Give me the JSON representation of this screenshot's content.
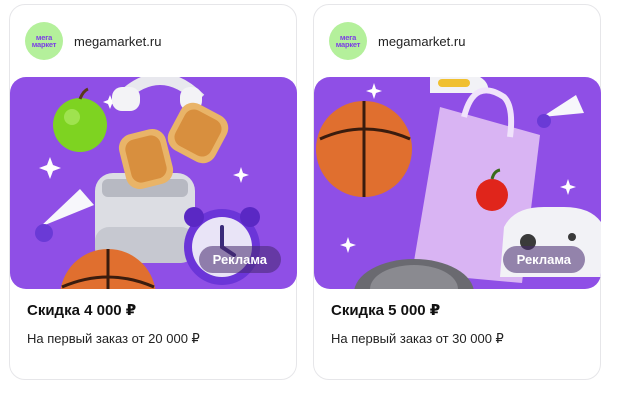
{
  "ads": [
    {
      "logo_line1": "мега",
      "logo_line2": "маркет",
      "domain": "megamarket.ru",
      "badge": "Реклама",
      "title": "Скидка 4 000 ₽",
      "subtitle": "На первый заказ от 20 000 ₽"
    },
    {
      "logo_line1": "мега",
      "logo_line2": "маркет",
      "domain": "megamarket.ru",
      "badge": "Реклама",
      "title": "Скидка 5 000 ₽",
      "subtitle": "На первый заказ от 30 000 ₽"
    }
  ],
  "colors": {
    "banner_bg": "#8f4fe6",
    "logo_bg": "#b4f09b",
    "logo_text": "#7b3fe4"
  }
}
